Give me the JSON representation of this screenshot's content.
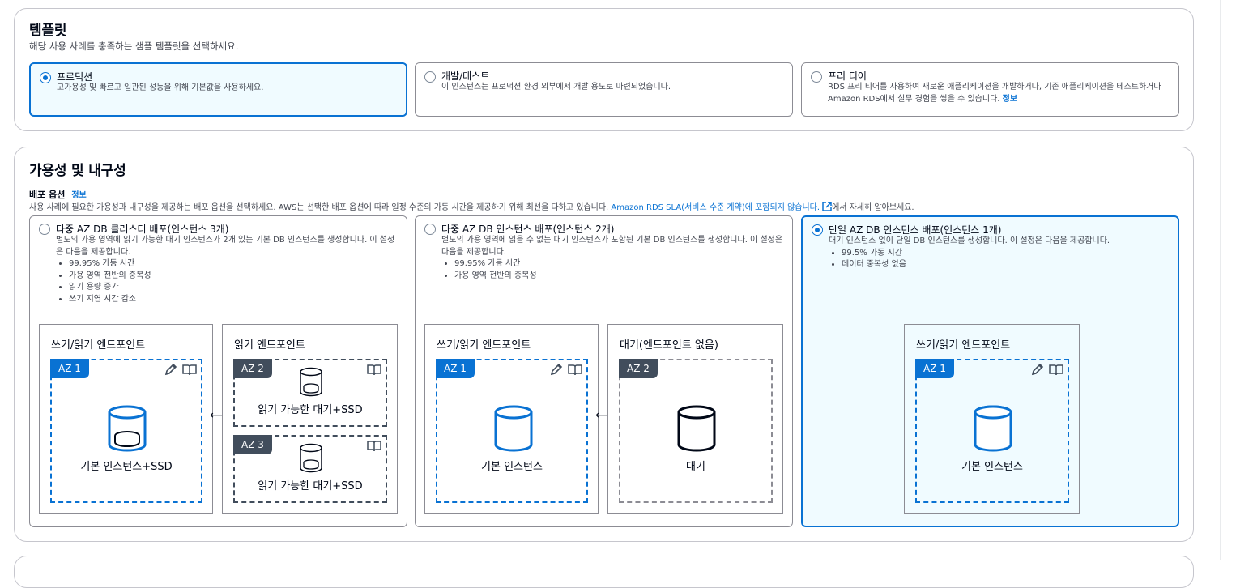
{
  "templates": {
    "heading": "템플릿",
    "description": "해당 사용 사례를 충족하는 샘플 템플릿을 선택하세요.",
    "options": [
      {
        "title": "프로덕션",
        "desc": "고가용성 및 빠르고 일관된 성능을 위해 기본값을 사용하세요.",
        "selected": true
      },
      {
        "title": "개발/테스트",
        "desc": "이 인스턴스는 프로덕션 환경 외부에서 개발 용도로 마련되었습니다.",
        "selected": false
      },
      {
        "title": "프리 티어",
        "desc": "RDS 프리 티어를 사용하여 새로운 애플리케이션을 개발하거나, 기존 애플리케이션을 테스트하거나 Amazon RDS에서 실무 경험을 쌓을 수 있습니다.",
        "info": "정보",
        "selected": false
      }
    ]
  },
  "availability": {
    "heading": "가용성 및 내구성",
    "deploy_label": "배포 옵션",
    "info": "정보",
    "desc_prefix": "사용 사례에 필요한 가용성과 내구성을 제공하는 배포 옵션을 선택하세요. AWS는 선택한 배포 옵션에 따라 일정 수준의 가동 시간을 제공하기 위해 최선을 다하고 있습니다.",
    "desc_link": "Amazon RDS SLA(서비스 수준 계약)에 포함되지 않습니다.",
    "desc_suffix": "에서 자세히 알아보세요.",
    "options": [
      {
        "title": "다중 AZ DB 클러스터 배포(인스턴스 3개)",
        "desc": "별도의 가용 영역에 읽기 가능한 대기 인스턴스가 2개 있는 기본 DB 인스턴스를 생성합니다. 이 설정은 다음을 제공합니다.",
        "bullets": [
          "99.95% 가동 시간",
          "가용 영역 전반의 중복성",
          "읽기 용량 증가",
          "쓰기 지연 시간 감소"
        ],
        "selected": false,
        "diagram": {
          "left_title": "쓰기/읽기 엔드포인트",
          "left_az": "AZ 1",
          "left_caption": "기본 인스턴스+SSD",
          "right_title": "읽기 엔드포인트",
          "az2": "AZ 2",
          "az2_caption": "읽기 가능한 대기+SSD",
          "az3": "AZ 3",
          "az3_caption": "읽기 가능한 대기+SSD"
        }
      },
      {
        "title": "다중 AZ DB 인스턴스 배포(인스턴스 2개)",
        "desc": "별도의 가용 영역에 읽을 수 없는 대기 인스턴스가 포함된 기본 DB 인스턴스를 생성합니다. 이 설정은 다음을 제공합니다.",
        "bullets": [
          "99.95% 가동 시간",
          "가용 영역 전반의 중복성"
        ],
        "selected": false,
        "diagram": {
          "left_title": "쓰기/읽기 엔드포인트",
          "left_az": "AZ 1",
          "left_caption": "기본 인스턴스",
          "right_title": "대기(엔드포인트 없음)",
          "az2": "AZ 2",
          "az2_caption": "대기"
        }
      },
      {
        "title": "단일 AZ DB 인스턴스 배포(인스턴스 1개)",
        "desc": "대기 인스턴스 없이 단일 DB 인스턴스를 생성합니다. 이 설정은 다음을 제공합니다.",
        "bullets": [
          "99.5% 가동 시간",
          "데이터 중복성 없음"
        ],
        "selected": true,
        "diagram": {
          "title": "쓰기/읽기 엔드포인트",
          "az": "AZ 1",
          "caption": "기본 인스턴스"
        }
      }
    ]
  },
  "colors": {
    "accent": "#0972d3",
    "dark_label": "#414d5c",
    "selected_bg": "#f0fbff"
  },
  "icons": [
    "edit-icon",
    "book-icon",
    "database-icon",
    "external-link-icon",
    "double-arrow-icon"
  ]
}
